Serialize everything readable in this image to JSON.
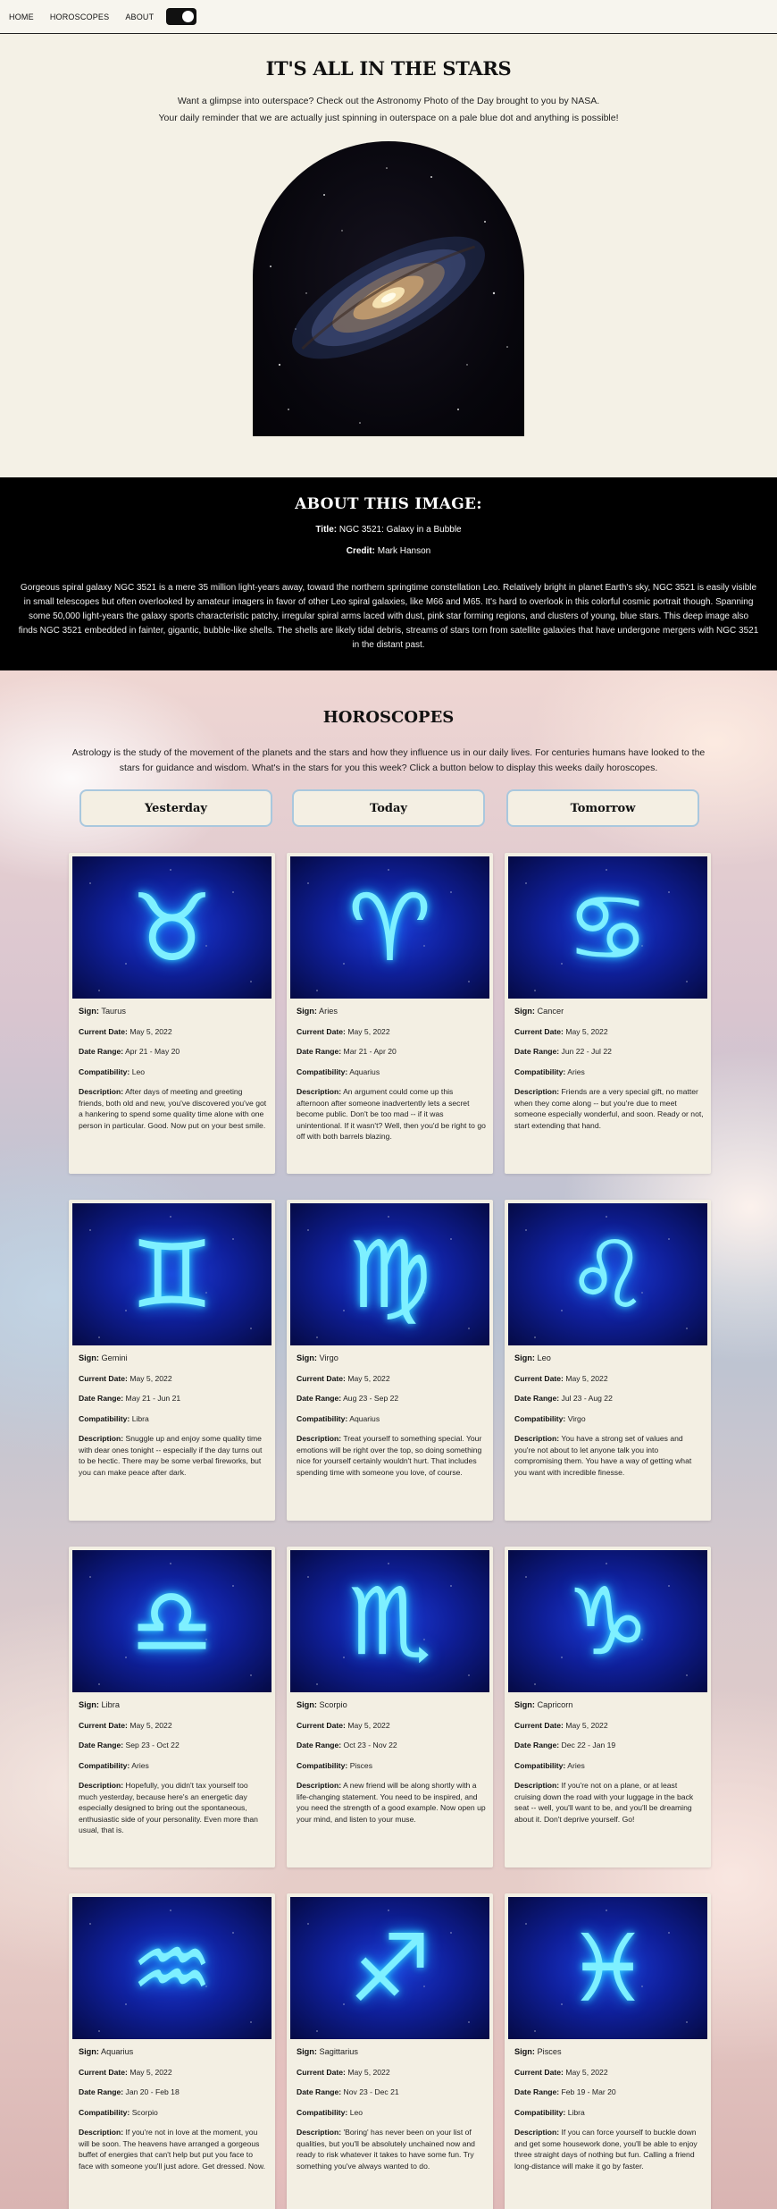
{
  "nav": {
    "home": "HOME",
    "horoscopes": "HOROSCOPES",
    "about": "ABOUT",
    "toggle_state": "on"
  },
  "hero": {
    "title": "IT'S ALL IN THE STARS",
    "intro_line1": "Want a glimpse into outerspace? Check out the Astronomy Photo of the Day brought to you by NASA.",
    "intro_line2": "Your daily reminder that we are actually just spinning in outerspace on a pale blue dot and anything is possible!"
  },
  "about": {
    "heading": "ABOUT THIS IMAGE:",
    "title_label": "Title:",
    "title_value": "NGC 3521: Galaxy in a Bubble",
    "credit_label": "Credit:",
    "credit_value": "Mark Hanson",
    "description": "Gorgeous spiral galaxy NGC 3521 is a mere 35 million light-years away, toward the northern springtime constellation Leo. Relatively bright in planet Earth's sky, NGC 3521 is easily visible in small telescopes but often overlooked by amateur imagers in favor of other Leo spiral galaxies, like M66 and M65. It's hard to overlook in this colorful cosmic portrait though. Spanning some 50,000 light-years the galaxy sports characteristic patchy, irregular spiral arms laced with dust, pink star forming regions, and clusters of young, blue stars. This deep image also finds NGC 3521 embedded in fainter, gigantic, bubble-like shells. The shells are likely tidal debris, streams of stars torn from satellite galaxies that have undergone mergers with NGC 3521 in the distant past."
  },
  "horoscopes": {
    "heading": "HOROSCOPES",
    "intro": "Astrology is the study of the movement of the planets and the stars and how they influence us in our daily lives. For centuries humans have looked to the stars for guidance and wisdom. What's in the stars for you this week? Click a button below to display this weeks daily horoscopes.",
    "buttons": [
      "Yesterday",
      "Today",
      "Tomorrow"
    ],
    "labels": {
      "sign": "Sign:",
      "current_date": "Current Date:",
      "date_range": "Date Range:",
      "compatibility": "Compatibility:",
      "description": "Description:"
    },
    "cards": [
      {
        "sign": "Taurus",
        "icon": "taurus-icon",
        "glyph": "♉",
        "current_date": "May 5, 2022",
        "date_range": "Apr 21 - May 20",
        "compatibility": "Leo",
        "description": "After days of meeting and greeting friends, both old and new, you've discovered you've got a hankering to spend some quality time alone with one person in particular. Good. Now put on your best smile."
      },
      {
        "sign": "Aries",
        "icon": "aries-icon",
        "glyph": "♈",
        "current_date": "May 5, 2022",
        "date_range": "Mar 21 - Apr 20",
        "compatibility": "Aquarius",
        "description": "An argument could come up this afternoon after someone inadvertently lets a secret become public. Don't be too mad -- if it was unintentional. If it wasn't? Well, then you'd be right to go off with both barrels blazing."
      },
      {
        "sign": "Cancer",
        "icon": "cancer-icon",
        "glyph": "♋",
        "current_date": "May 5, 2022",
        "date_range": "Jun 22 - Jul 22",
        "compatibility": "Aries",
        "description": "Friends are a very special gift, no matter when they come along -- but you're due to meet someone especially wonderful, and soon. Ready or not, start extending that hand."
      },
      {
        "sign": "Gemini",
        "icon": "gemini-icon",
        "glyph": "♊",
        "current_date": "May 5, 2022",
        "date_range": "May 21 - Jun 21",
        "compatibility": "Libra",
        "description": "Snuggle up and enjoy some quality time with dear ones tonight -- especially if the day turns out to be hectic. There may be some verbal fireworks, but you can make peace after dark."
      },
      {
        "sign": "Virgo",
        "icon": "virgo-icon",
        "glyph": "♍",
        "current_date": "May 5, 2022",
        "date_range": "Aug 23 - Sep 22",
        "compatibility": "Aquarius",
        "description": "Treat yourself to something special. Your emotions will be right over the top, so doing something nice for yourself certainly wouldn't hurt. That includes spending time with someone you love, of course."
      },
      {
        "sign": "Leo",
        "icon": "leo-icon",
        "glyph": "♌",
        "current_date": "May 5, 2022",
        "date_range": "Jul 23 - Aug 22",
        "compatibility": "Virgo",
        "description": "You have a strong set of values and you're not about to let anyone talk you into compromising them. You have a way of getting what you want with incredible finesse."
      },
      {
        "sign": "Libra",
        "icon": "libra-icon",
        "glyph": "♎",
        "current_date": "May 5, 2022",
        "date_range": "Sep 23 - Oct 22",
        "compatibility": "Aries",
        "description": "Hopefully, you didn't tax yourself too much yesterday, because here's an energetic day especially designed to bring out the spontaneous, enthusiastic side of your personality. Even more than usual, that is."
      },
      {
        "sign": "Scorpio",
        "icon": "scorpio-icon",
        "glyph": "♏",
        "current_date": "May 5, 2022",
        "date_range": "Oct 23 - Nov 22",
        "compatibility": "Pisces",
        "description": "A new friend will be along shortly with a life-changing statement. You need to be inspired, and you need the strength of a good example. Now open up your mind, and listen to your muse."
      },
      {
        "sign": "Capricorn",
        "icon": "capricorn-icon",
        "glyph": "♑",
        "current_date": "May 5, 2022",
        "date_range": "Dec 22 - Jan 19",
        "compatibility": "Aries",
        "description": "If you're not on a plane, or at least cruising down the road with your luggage in the back seat -- well, you'll want to be, and you'll be dreaming about it. Don't deprive yourself. Go!"
      },
      {
        "sign": "Aquarius",
        "icon": "aquarius-icon",
        "glyph": "♒",
        "current_date": "May 5, 2022",
        "date_range": "Jan 20 - Feb 18",
        "compatibility": "Scorpio",
        "description": "If you're not in love at the moment, you will be soon. The heavens have arranged a gorgeous buffet of energies that can't help but put you face to face with someone you'll just adore. Get dressed. Now."
      },
      {
        "sign": "Sagittarius",
        "icon": "sagittarius-icon",
        "glyph": "♐",
        "current_date": "May 5, 2022",
        "date_range": "Nov 23 - Dec 21",
        "compatibility": "Leo",
        "description": "'Boring' has never been on your list of qualities, but you'll be absolutely unchained now and ready to risk whatever it takes to have some fun. Try something you've always wanted to do."
      },
      {
        "sign": "Pisces",
        "icon": "pisces-icon",
        "glyph": "♓",
        "current_date": "May 5, 2022",
        "date_range": "Feb 19 - Mar 20",
        "compatibility": "Libra",
        "description": "If you can force yourself to buckle down and get some housework done, you'll be able to enjoy three straight days of nothing but fun. Calling a friend long-distance will make it go by faster."
      }
    ]
  }
}
